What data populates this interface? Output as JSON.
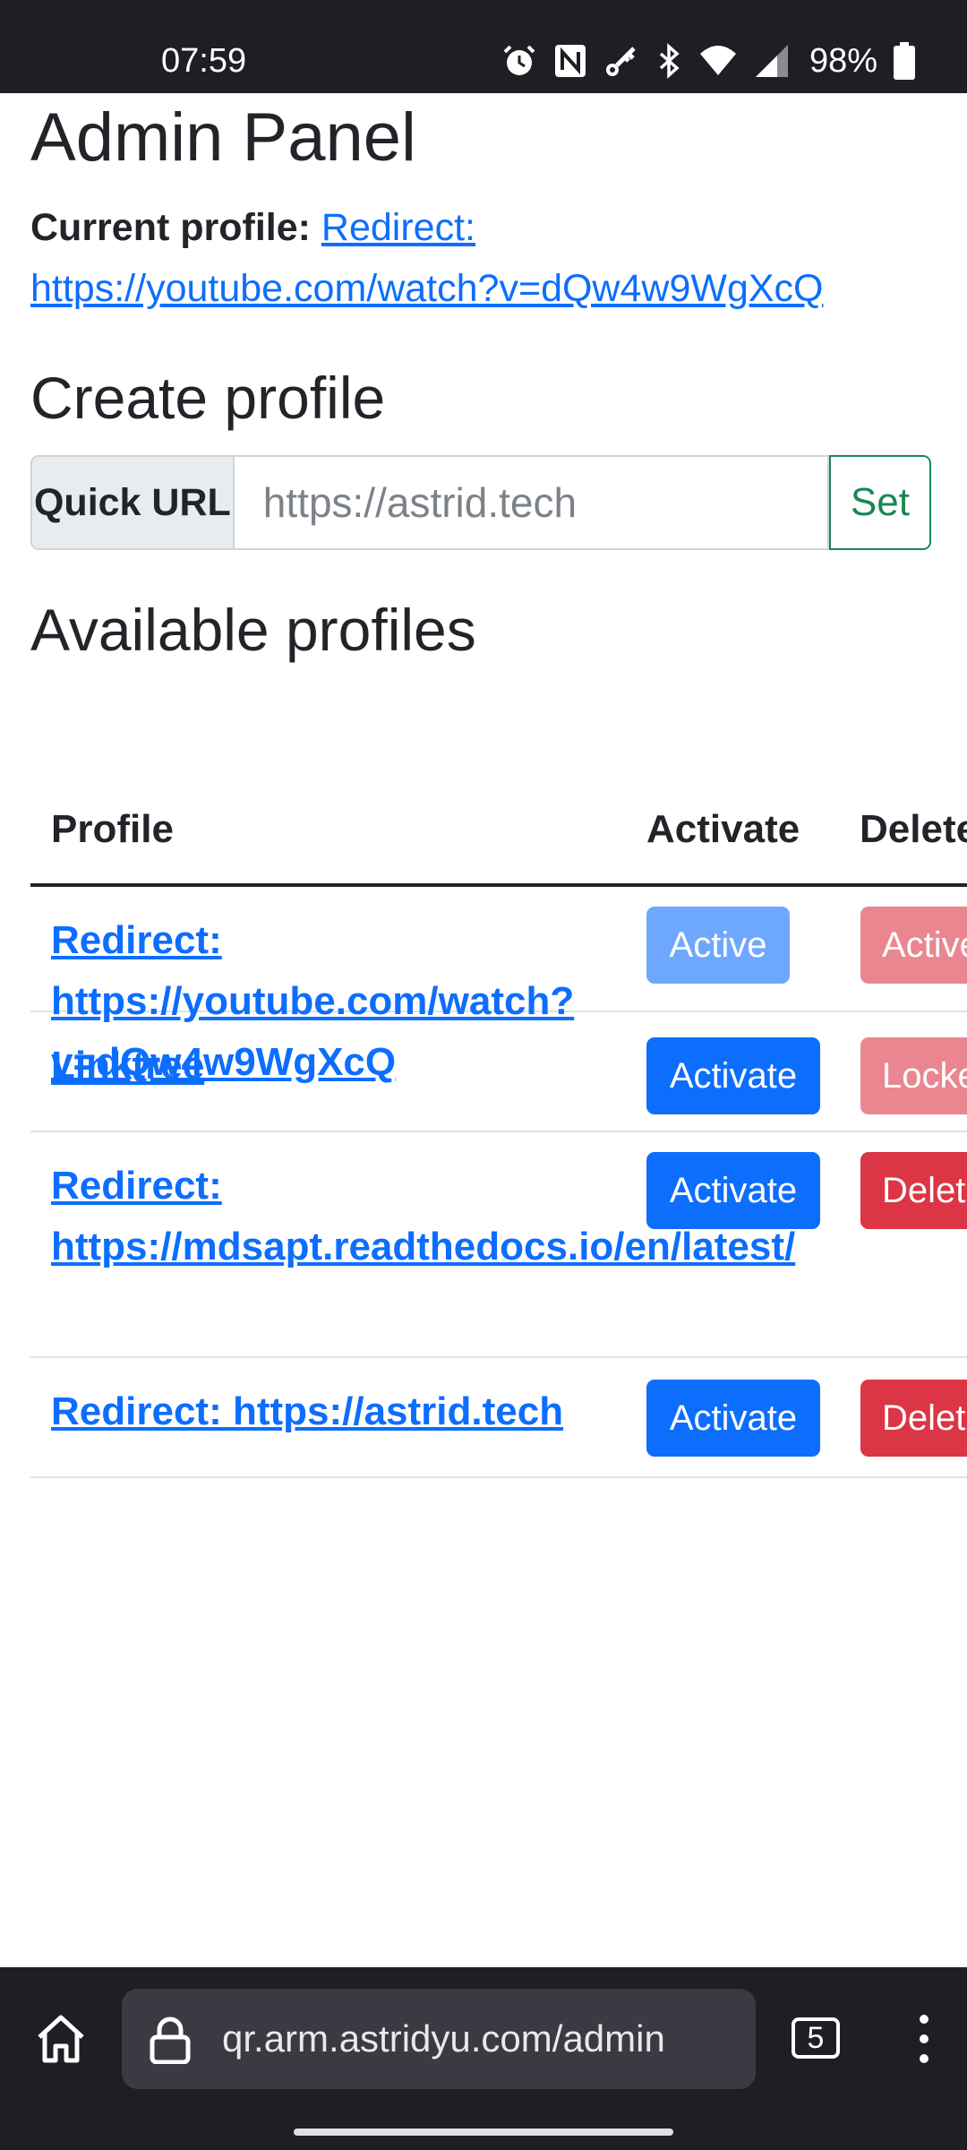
{
  "status_bar": {
    "time": "07:59",
    "battery": "98%",
    "icons": [
      "alarm-icon",
      "nfc-icon",
      "vpn-key-icon",
      "bluetooth-icon",
      "wifi-icon",
      "signal-icon",
      "battery-icon"
    ]
  },
  "page": {
    "title": "Admin Panel",
    "current_profile_label": "Current profile:",
    "current_profile_link": "Redirect: https://youtube.com/watch?v=dQw4w9WgXcQ",
    "create_title": "Create profile",
    "quick_url_label": "Quick URL",
    "quick_url_placeholder": "https://astrid.tech",
    "set_label": "Set",
    "available_title": "Available profiles"
  },
  "table": {
    "headers": {
      "profile": "Profile",
      "activate": "Activate",
      "delete": "Delete"
    },
    "rows": [
      {
        "profile": "Redirect: https://youtube.com/watch?v=dQw4w9WgXcQ",
        "activate": "Active",
        "delete": "Active"
      },
      {
        "profile": "Linktree",
        "activate": "Activate",
        "delete": "Locked"
      },
      {
        "profile": "Redirect: https://mdsapt.readthedocs.io/en/latest/",
        "activate": "Activate",
        "delete": "Delete"
      },
      {
        "profile": "Redirect: https://astrid.tech",
        "activate": "Activate",
        "delete": "Delete"
      }
    ]
  },
  "colors": {
    "primary": "#0d6efd",
    "primary_disabled": "#6ea8fe",
    "danger": "#dc3545",
    "danger_disabled": "#ea868f",
    "success": "#198754",
    "system_bar": "#1e1e24"
  },
  "browser": {
    "url": "qr.arm.astridyu.com/admin",
    "tab_count": "5"
  }
}
